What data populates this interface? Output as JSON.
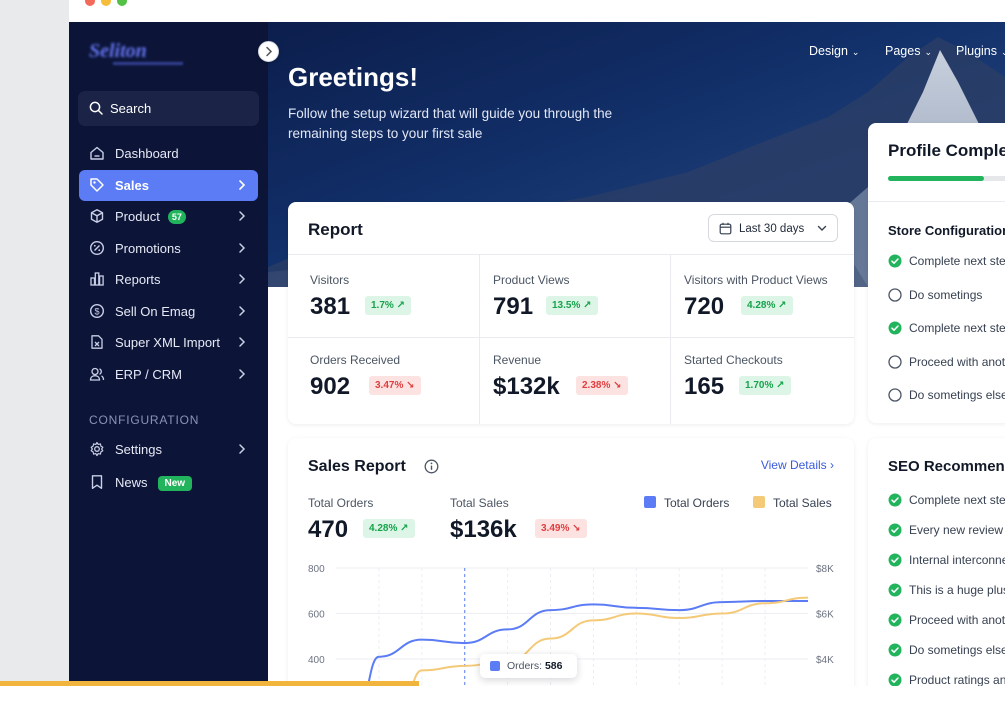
{
  "window": {
    "controls": [
      "close",
      "minimize",
      "maximize"
    ]
  },
  "brand": {
    "logo_text": "Seliton"
  },
  "sidebar": {
    "search_label": "Search",
    "items": [
      {
        "label": "Dashboard",
        "icon": "home-icon"
      },
      {
        "label": "Sales",
        "icon": "tag-icon",
        "active": true
      },
      {
        "label": "Product",
        "icon": "box-icon",
        "badge": "57"
      },
      {
        "label": "Promotions",
        "icon": "percent-icon"
      },
      {
        "label": "Reports",
        "icon": "bar-chart-icon"
      },
      {
        "label": "Sell On Emag",
        "icon": "dollar-icon"
      },
      {
        "label": "Super XML Import",
        "icon": "file-import-icon"
      },
      {
        "label": "ERP / CRM",
        "icon": "users-icon"
      }
    ],
    "config_title": "CONFIGURATION",
    "config_items": [
      {
        "label": "Settings",
        "icon": "gear-icon"
      },
      {
        "label": "News",
        "icon": "bookmark-icon",
        "badge": "New"
      }
    ]
  },
  "topnav": {
    "items": [
      "Design",
      "Pages",
      "Plugins"
    ]
  },
  "hero": {
    "title": "Greetings!",
    "subtitle": "Follow the setup wizard that will guide you through the remaining steps to your first sale"
  },
  "report": {
    "title": "Report",
    "date_range": "Last 30 days",
    "metrics": [
      {
        "label": "Visitors",
        "value": "381",
        "change": "1.7%",
        "trend": "up"
      },
      {
        "label": "Product Views",
        "value": "791",
        "change": "13.5%",
        "trend": "up"
      },
      {
        "label": "Visitors with Product Views",
        "value": "720",
        "change": "4.28%",
        "trend": "up"
      },
      {
        "label": "Orders Received",
        "value": "902",
        "change": "3.47%",
        "trend": "down"
      },
      {
        "label": "Revenue",
        "value": "$132k",
        "change": "2.38%",
        "trend": "down"
      },
      {
        "label": "Started Checkouts",
        "value": "165",
        "change": "1.70%",
        "trend": "up"
      }
    ]
  },
  "sales_report": {
    "title": "Sales Report",
    "view_details": "View Details",
    "total_orders_label": "Total Orders",
    "total_orders_value": "470",
    "total_orders_change": "4.28%",
    "total_sales_label": "Total Sales",
    "total_sales_value": "$136k",
    "total_sales_change": "3.49%",
    "tooltip_label": "Orders:",
    "tooltip_value": "586"
  },
  "chart_data": {
    "type": "line",
    "series": [
      {
        "name": "Total Orders",
        "color": "#5b7cf5",
        "axis": "left",
        "values": [
          null,
          410,
          485,
          470,
          530,
          615,
          640,
          625,
          615,
          650,
          655,
          655
        ]
      },
      {
        "name": "Total Sales",
        "color": "#f4c978",
        "axis": "right",
        "values": [
          null,
          null,
          3500,
          3700,
          3900,
          4900,
          5700,
          6000,
          5800,
          6000,
          6450,
          6700
        ]
      }
    ],
    "y_left_ticks": [
      "800",
      "600",
      "400"
    ],
    "y_right_ticks": [
      "$8K",
      "$6K",
      "$4K"
    ],
    "ylim_left": [
      400,
      800
    ],
    "ylim_right": [
      4000,
      8000
    ],
    "grid": true
  },
  "profile": {
    "title": "Profile Completion",
    "progress": 0.6,
    "section": "Store Configuration",
    "tasks": [
      {
        "label": "Complete next step",
        "done": true
      },
      {
        "label": "Do sometings",
        "done": false
      },
      {
        "label": "Complete next step",
        "done": true
      },
      {
        "label": "Proceed with another",
        "done": false
      },
      {
        "label": "Do sometings else",
        "done": false
      }
    ]
  },
  "seo": {
    "title": "SEO Recommendations",
    "tasks": [
      {
        "label": "Complete next step"
      },
      {
        "label": "Every new review"
      },
      {
        "label": "Internal interconnect"
      },
      {
        "label": "This is a huge plus"
      },
      {
        "label": "Proceed with another"
      },
      {
        "label": "Do sometings else"
      },
      {
        "label": "Product ratings and"
      }
    ]
  }
}
